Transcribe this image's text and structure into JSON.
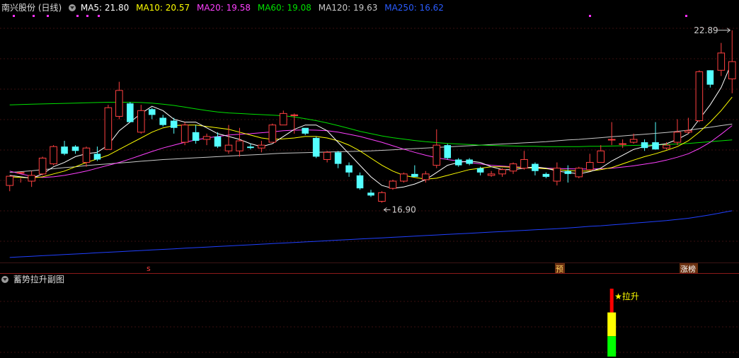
{
  "legend": {
    "stock": "南兴股份 (日线)",
    "ma5": "MA5: 21.80",
    "ma10": "MA10: 20.57",
    "ma20": "MA20: 19.58",
    "ma60": "MA60: 19.08",
    "ma120": "MA120: 19.63",
    "ma250": "MA250: 16.62"
  },
  "colors": {
    "up": "#ff4040",
    "down": "#54ffff",
    "ma5": "#ffffff",
    "ma10": "#ffff00",
    "ma20": "#ff40ff",
    "ma60": "#00e000",
    "ma120": "#c8c8c8",
    "ma250": "#2040ff",
    "grid": "#3a1010",
    "separator": "#8b1a1a",
    "marker_bg": "#6a3010"
  },
  "annotations": {
    "high": "22.89",
    "low": "16.90",
    "marker_s": "s",
    "marker_yu": "预",
    "marker_zhangbang": "涨榜"
  },
  "sub_panel": {
    "title": "蓄势拉升副图",
    "signal_label": "★拉升",
    "signal_bar_index": 55
  },
  "chart_data": [
    {
      "type": "candlestick",
      "title": "",
      "ylim": [
        14.8,
        23.4
      ],
      "ohlc": [
        [
          17.5,
          17.82,
          17.3,
          17.8
        ],
        [
          17.95,
          17.95,
          17.6,
          17.75
        ],
        [
          17.65,
          17.85,
          17.45,
          18.0
        ],
        [
          17.9,
          18.45,
          17.85,
          18.5
        ],
        [
          18.25,
          18.85,
          18.2,
          18.9
        ],
        [
          18.85,
          18.6,
          18.55,
          19.05
        ],
        [
          18.85,
          18.7,
          18.6,
          18.9
        ],
        [
          18.3,
          18.8,
          18.15,
          18.85
        ],
        [
          18.6,
          18.4,
          18.35,
          18.85
        ],
        [
          18.75,
          20.2,
          18.75,
          20.3
        ],
        [
          19.9,
          20.8,
          19.8,
          21.1
        ],
        [
          20.35,
          19.7,
          19.7,
          20.4
        ],
        [
          19.35,
          20.1,
          19.3,
          20.3
        ],
        [
          20.15,
          19.95,
          19.8,
          20.2
        ],
        [
          19.85,
          19.6,
          19.55,
          19.95
        ],
        [
          19.75,
          19.5,
          19.3,
          19.85
        ],
        [
          19.0,
          19.6,
          18.9,
          19.7
        ],
        [
          19.35,
          19.05,
          18.95,
          19.6
        ],
        [
          19.1,
          19.2,
          18.9,
          19.3
        ],
        [
          19.2,
          18.85,
          18.8,
          19.35
        ],
        [
          18.7,
          18.9,
          18.6,
          19.6
        ],
        [
          18.7,
          19.05,
          18.5,
          19.5
        ],
        [
          18.85,
          18.8,
          18.75,
          18.95
        ],
        [
          18.8,
          18.9,
          18.65,
          19.05
        ],
        [
          19.0,
          19.6,
          19.0,
          19.65
        ],
        [
          19.6,
          20.0,
          19.6,
          20.1
        ],
        [
          19.95,
          19.95,
          19.3,
          20.0
        ],
        [
          19.5,
          19.3,
          19.25,
          19.4
        ],
        [
          19.15,
          18.5,
          18.45,
          19.2
        ],
        [
          18.4,
          18.65,
          18.3,
          18.7
        ],
        [
          18.65,
          18.25,
          18.1,
          18.7
        ],
        [
          18.2,
          17.95,
          17.8,
          18.3
        ],
        [
          17.85,
          17.4,
          17.35,
          17.95
        ],
        [
          17.25,
          17.15,
          17.1,
          17.35
        ],
        [
          16.95,
          17.25,
          16.9,
          17.3
        ],
        [
          17.4,
          17.65,
          17.35,
          17.7
        ],
        [
          17.65,
          17.9,
          17.6,
          17.95
        ],
        [
          17.9,
          17.8,
          17.8,
          18.2
        ],
        [
          17.7,
          17.9,
          17.6,
          18.0
        ],
        [
          18.2,
          18.9,
          18.1,
          19.45
        ],
        [
          18.9,
          18.45,
          18.4,
          18.95
        ],
        [
          18.4,
          18.2,
          18.15,
          18.45
        ],
        [
          18.4,
          18.25,
          18.2,
          18.45
        ],
        [
          18.1,
          17.95,
          17.85,
          18.15
        ],
        [
          17.85,
          17.9,
          17.8,
          18.0
        ],
        [
          17.9,
          18.05,
          17.8,
          18.1
        ],
        [
          18.0,
          18.25,
          17.9,
          18.3
        ],
        [
          18.1,
          18.4,
          18.05,
          18.7
        ],
        [
          18.25,
          18.0,
          17.85,
          18.3
        ],
        [
          17.9,
          17.8,
          17.75,
          17.95
        ],
        [
          17.65,
          18.1,
          17.5,
          18.3
        ],
        [
          18.0,
          17.9,
          17.6,
          18.2
        ],
        [
          17.8,
          18.1,
          17.75,
          18.15
        ],
        [
          18.05,
          18.3,
          18.0,
          18.6
        ],
        [
          18.3,
          18.7,
          18.3,
          18.9
        ],
        [
          19.1,
          19.1,
          18.9,
          19.7
        ],
        [
          18.95,
          18.95,
          18.8,
          19.1
        ],
        [
          19.0,
          19.1,
          18.95,
          19.3
        ],
        [
          19.0,
          18.8,
          18.7,
          19.1
        ],
        [
          19.0,
          18.75,
          18.75,
          19.7
        ],
        [
          18.8,
          18.9,
          18.75,
          19.0
        ],
        [
          19.0,
          19.35,
          18.9,
          19.8
        ],
        [
          19.35,
          19.4,
          19.3,
          19.85
        ],
        [
          19.75,
          21.45,
          19.7,
          21.5
        ],
        [
          21.5,
          21.0,
          20.9,
          21.5
        ],
        [
          21.5,
          22.1,
          21.3,
          22.45
        ],
        [
          21.2,
          21.8,
          20.7,
          22.89
        ]
      ],
      "ma5": [
        17.85,
        17.8,
        17.75,
        17.9,
        18.15,
        18.3,
        18.5,
        18.6,
        18.65,
        18.9,
        19.4,
        19.7,
        20.0,
        20.25,
        20.1,
        19.8,
        19.7,
        19.7,
        19.5,
        19.3,
        19.2,
        19.1,
        18.95,
        18.85,
        18.95,
        19.2,
        19.45,
        19.6,
        19.6,
        19.4,
        19.0,
        18.6,
        18.2,
        17.8,
        17.5,
        17.4,
        17.45,
        17.55,
        17.7,
        17.95,
        18.2,
        18.3,
        18.35,
        18.3,
        18.15,
        18.05,
        18.05,
        18.1,
        18.15,
        18.1,
        18.0,
        17.95,
        17.9,
        17.98,
        18.1,
        18.35,
        18.55,
        18.75,
        18.85,
        18.9,
        18.95,
        19.1,
        19.3,
        19.8,
        20.3,
        20.9,
        21.8
      ],
      "ma10": [
        17.8,
        17.78,
        17.76,
        17.8,
        17.9,
        18.0,
        18.15,
        18.3,
        18.42,
        18.55,
        18.75,
        18.95,
        19.15,
        19.35,
        19.5,
        19.58,
        19.6,
        19.6,
        19.55,
        19.5,
        19.45,
        19.35,
        19.25,
        19.15,
        19.1,
        19.12,
        19.15,
        19.2,
        19.2,
        19.15,
        19.05,
        18.9,
        18.7,
        18.45,
        18.2,
        18.0,
        17.85,
        17.78,
        17.72,
        17.75,
        17.85,
        17.95,
        18.05,
        18.1,
        18.15,
        18.15,
        18.13,
        18.12,
        18.1,
        18.08,
        18.05,
        18.02,
        18.0,
        18.0,
        18.05,
        18.12,
        18.25,
        18.38,
        18.5,
        18.6,
        18.72,
        18.85,
        19.05,
        19.35,
        19.7,
        20.1,
        20.57
      ],
      "ma20": [
        18.0,
        17.9,
        17.82,
        17.78,
        17.8,
        17.85,
        17.92,
        18.0,
        18.1,
        18.2,
        18.3,
        18.42,
        18.55,
        18.68,
        18.8,
        18.9,
        19.0,
        19.08,
        19.15,
        19.2,
        19.25,
        19.28,
        19.3,
        19.33,
        19.36,
        19.4,
        19.42,
        19.43,
        19.42,
        19.4,
        19.35,
        19.28,
        19.2,
        19.1,
        19.0,
        18.88,
        18.76,
        18.65,
        18.55,
        18.46,
        18.4,
        18.35,
        18.3,
        18.25,
        18.2,
        18.17,
        18.15,
        18.13,
        18.11,
        18.1,
        18.09,
        18.08,
        18.07,
        18.07,
        18.08,
        18.1,
        18.14,
        18.18,
        18.24,
        18.3,
        18.38,
        18.48,
        18.6,
        18.78,
        19.0,
        19.28,
        19.58
      ],
      "ma60": [
        20.3,
        20.31,
        20.32,
        20.33,
        20.34,
        20.35,
        20.36,
        20.37,
        20.38,
        20.39,
        20.39,
        20.39,
        20.38,
        20.36,
        20.32,
        20.28,
        20.22,
        20.16,
        20.1,
        20.05,
        20.02,
        20.0,
        19.98,
        19.96,
        19.94,
        19.92,
        19.88,
        19.82,
        19.75,
        19.67,
        19.58,
        19.48,
        19.38,
        19.3,
        19.22,
        19.16,
        19.11,
        19.06,
        19.02,
        18.99,
        18.96,
        18.94,
        18.92,
        18.9,
        18.89,
        18.88,
        18.87,
        18.86,
        18.86,
        18.85,
        18.85,
        18.85,
        18.85,
        18.86,
        18.86,
        18.87,
        18.88,
        18.89,
        18.9,
        18.91,
        18.92,
        18.94,
        18.96,
        18.99,
        19.02,
        19.05,
        19.08
      ],
      "ma120": [
        17.95,
        17.98,
        18.01,
        18.05,
        18.08,
        18.12,
        18.15,
        18.19,
        18.22,
        18.25,
        18.28,
        18.31,
        18.34,
        18.37,
        18.4,
        18.42,
        18.44,
        18.46,
        18.48,
        18.5,
        18.52,
        18.54,
        18.56,
        18.58,
        18.6,
        18.62,
        18.63,
        18.64,
        18.65,
        18.66,
        18.67,
        18.68,
        18.69,
        18.7,
        18.72,
        18.74,
        18.76,
        18.78,
        18.8,
        18.82,
        18.84,
        18.86,
        18.88,
        18.9,
        18.92,
        18.94,
        18.96,
        18.98,
        19.0,
        19.02,
        19.05,
        19.08,
        19.1,
        19.13,
        19.16,
        19.19,
        19.22,
        19.25,
        19.28,
        19.31,
        19.34,
        19.38,
        19.42,
        19.47,
        19.52,
        19.58,
        19.63
      ],
      "ma250": [
        15.0,
        15.02,
        15.04,
        15.06,
        15.08,
        15.1,
        15.12,
        15.14,
        15.16,
        15.18,
        15.2,
        15.22,
        15.24,
        15.26,
        15.28,
        15.3,
        15.32,
        15.34,
        15.36,
        15.38,
        15.4,
        15.42,
        15.44,
        15.46,
        15.48,
        15.5,
        15.52,
        15.54,
        15.56,
        15.58,
        15.6,
        15.62,
        15.64,
        15.66,
        15.68,
        15.7,
        15.72,
        15.74,
        15.76,
        15.78,
        15.8,
        15.82,
        15.84,
        15.86,
        15.88,
        15.9,
        15.92,
        15.94,
        15.96,
        15.98,
        16.0,
        16.02,
        16.05,
        16.08,
        16.1,
        16.13,
        16.16,
        16.19,
        16.22,
        16.25,
        16.28,
        16.32,
        16.36,
        16.42,
        16.48,
        16.55,
        16.62
      ]
    },
    {
      "type": "bar",
      "title": "",
      "segments": [
        {
          "name": "",
          "color": "#ff0000",
          "value": 0.35
        },
        {
          "name": "",
          "color": "#ffff00",
          "value": 0.35
        },
        {
          "name": "",
          "color": "#00ff00",
          "value": 0.3
        }
      ]
    }
  ]
}
